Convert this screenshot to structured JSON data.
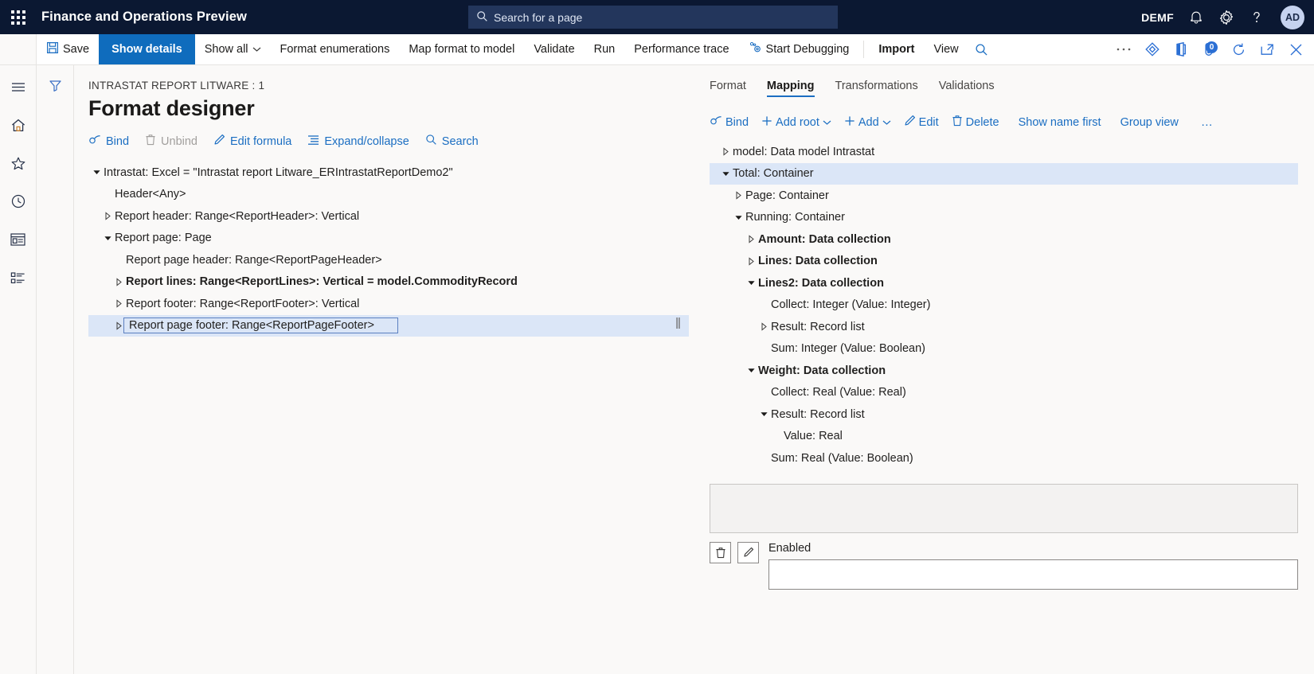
{
  "topbar": {
    "waffle": "app-launcher",
    "app_title": "Finance and Operations Preview",
    "search_placeholder": "Search for a page",
    "company": "DEMF",
    "avatar_initials": "AD",
    "accent": "#0b1832"
  },
  "commandbar": {
    "save_label": "Save",
    "show_details_label": "Show details",
    "show_all_label": "Show all",
    "format_enumerations_label": "Format enumerations",
    "map_format_label": "Map format to model",
    "validate_label": "Validate",
    "run_label": "Run",
    "performance_trace_label": "Performance trace",
    "start_debugging_label": "Start Debugging",
    "import_label": "Import",
    "view_label": "View",
    "notification_count": "0"
  },
  "header": {
    "breadcrumb": "INTRASTAT REPORT LITWARE : 1",
    "title": "Format designer"
  },
  "format_actions": {
    "bind": "Bind",
    "unbind": "Unbind",
    "edit_formula": "Edit formula",
    "expand_collapse": "Expand/collapse",
    "search": "Search"
  },
  "format_tree": [
    {
      "label": "Intrastat: Excel = \"Intrastat report Litware_ERIntrastatReportDemo2\"",
      "indent": 0,
      "state": "expanded",
      "bold": false,
      "selected": false
    },
    {
      "label": "Header<Any>",
      "indent": 1,
      "state": "leaf",
      "bold": false,
      "selected": false
    },
    {
      "label": "Report header: Range<ReportHeader>: Vertical",
      "indent": 1,
      "state": "collapsed",
      "bold": false,
      "selected": false
    },
    {
      "label": "Report page: Page",
      "indent": 1,
      "state": "expanded",
      "bold": false,
      "selected": false
    },
    {
      "label": "Report page header: Range<ReportPageHeader>",
      "indent": 2,
      "state": "leaf",
      "bold": false,
      "selected": false
    },
    {
      "label": "Report lines: Range<ReportLines>: Vertical = model.CommodityRecord",
      "indent": 2,
      "state": "collapsed",
      "bold": true,
      "selected": false
    },
    {
      "label": "Report footer: Range<ReportFooter>: Vertical",
      "indent": 2,
      "state": "collapsed",
      "bold": false,
      "selected": false
    },
    {
      "label": "Report page footer: Range<ReportPageFooter>",
      "indent": 2,
      "state": "collapsed",
      "bold": false,
      "selected": true
    }
  ],
  "right_tabs": [
    {
      "label": "Format",
      "active": false
    },
    {
      "label": "Mapping",
      "active": true
    },
    {
      "label": "Transformations",
      "active": false
    },
    {
      "label": "Validations",
      "active": false
    }
  ],
  "mapping_actions": {
    "bind": "Bind",
    "add_root": "Add root",
    "add": "Add",
    "edit": "Edit",
    "delete": "Delete",
    "show_name_first": "Show name first",
    "group_view": "Group view",
    "overflow": "…"
  },
  "mapping_tree": [
    {
      "label": "model: Data model Intrastat",
      "indent": 0,
      "state": "collapsed",
      "bold": false,
      "selected": false
    },
    {
      "label": "Total: Container",
      "indent": 0,
      "state": "expanded",
      "bold": false,
      "selected": true
    },
    {
      "label": "Page: Container",
      "indent": 1,
      "state": "collapsed",
      "bold": false,
      "selected": false
    },
    {
      "label": "Running: Container",
      "indent": 1,
      "state": "expanded",
      "bold": false,
      "selected": false
    },
    {
      "label": "Amount: Data collection",
      "indent": 2,
      "state": "collapsed",
      "bold": true,
      "selected": false
    },
    {
      "label": "Lines: Data collection",
      "indent": 2,
      "state": "collapsed",
      "bold": true,
      "selected": false
    },
    {
      "label": "Lines2: Data collection",
      "indent": 2,
      "state": "expanded",
      "bold": true,
      "selected": false
    },
    {
      "label": "Collect: Integer (Value: Integer)",
      "indent": 3,
      "state": "leaf",
      "bold": false,
      "selected": false
    },
    {
      "label": "Result: Record list",
      "indent": 3,
      "state": "collapsed",
      "bold": false,
      "selected": false
    },
    {
      "label": "Sum: Integer (Value: Boolean)",
      "indent": 3,
      "state": "leaf",
      "bold": false,
      "selected": false
    },
    {
      "label": "Weight: Data collection",
      "indent": 2,
      "state": "expanded",
      "bold": true,
      "selected": false
    },
    {
      "label": "Collect: Real (Value: Real)",
      "indent": 3,
      "state": "leaf",
      "bold": false,
      "selected": false
    },
    {
      "label": "Result: Record list",
      "indent": 3,
      "state": "expanded",
      "bold": false,
      "selected": false
    },
    {
      "label": "Value: Real",
      "indent": 4,
      "state": "leaf",
      "bold": false,
      "selected": false
    },
    {
      "label": "Sum: Real (Value: Boolean)",
      "indent": 3,
      "state": "leaf",
      "bold": false,
      "selected": false
    }
  ],
  "formula_panel": {
    "expression_value": "",
    "enabled_label": "Enabled",
    "enabled_value": ""
  },
  "navrail": [
    {
      "icon": "hamburger-menu-icon",
      "name": "nav-menu"
    },
    {
      "icon": "home-icon",
      "name": "nav-home"
    },
    {
      "icon": "star-icon",
      "name": "nav-favorites"
    },
    {
      "icon": "clock-icon",
      "name": "nav-recent"
    },
    {
      "icon": "workspace-icon",
      "name": "nav-workspaces"
    },
    {
      "icon": "modules-list-icon",
      "name": "nav-modules"
    }
  ],
  "colors": {
    "accent_blue": "#0f6cbd",
    "link_blue": "#1b6ec2",
    "selection_blue": "#dbe6f7",
    "topbar_navy": "#0b1832",
    "page_bg": "#faf9f8"
  }
}
